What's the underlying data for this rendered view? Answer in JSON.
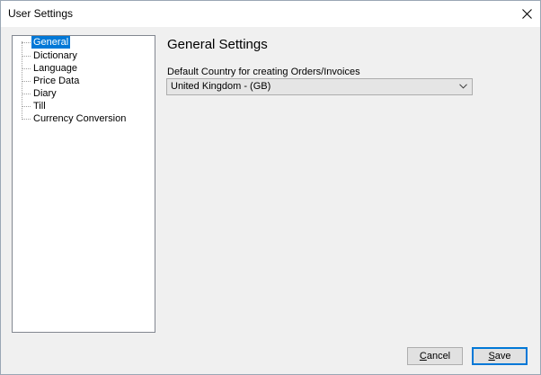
{
  "window": {
    "title": "User Settings"
  },
  "tree": {
    "items": [
      {
        "label": "General",
        "selected": true
      },
      {
        "label": "Dictionary",
        "selected": false
      },
      {
        "label": "Language",
        "selected": false
      },
      {
        "label": "Price Data",
        "selected": false
      },
      {
        "label": "Diary",
        "selected": false
      },
      {
        "label": "Till",
        "selected": false
      },
      {
        "label": "Currency Conversion",
        "selected": false
      }
    ]
  },
  "main": {
    "section_title": "General Settings",
    "country_label": "Default Country for creating Orders/Invoices",
    "country_value": "United Kingdom - (GB)"
  },
  "buttons": {
    "cancel_label": "Cancel",
    "save_label": "Save"
  },
  "colors": {
    "selection": "#0078d7",
    "default_button_border": "#0078d7",
    "window_background": "#f0f0f0"
  },
  "icons": {
    "close": "close-icon",
    "dropdown": "chevron-down-icon"
  }
}
